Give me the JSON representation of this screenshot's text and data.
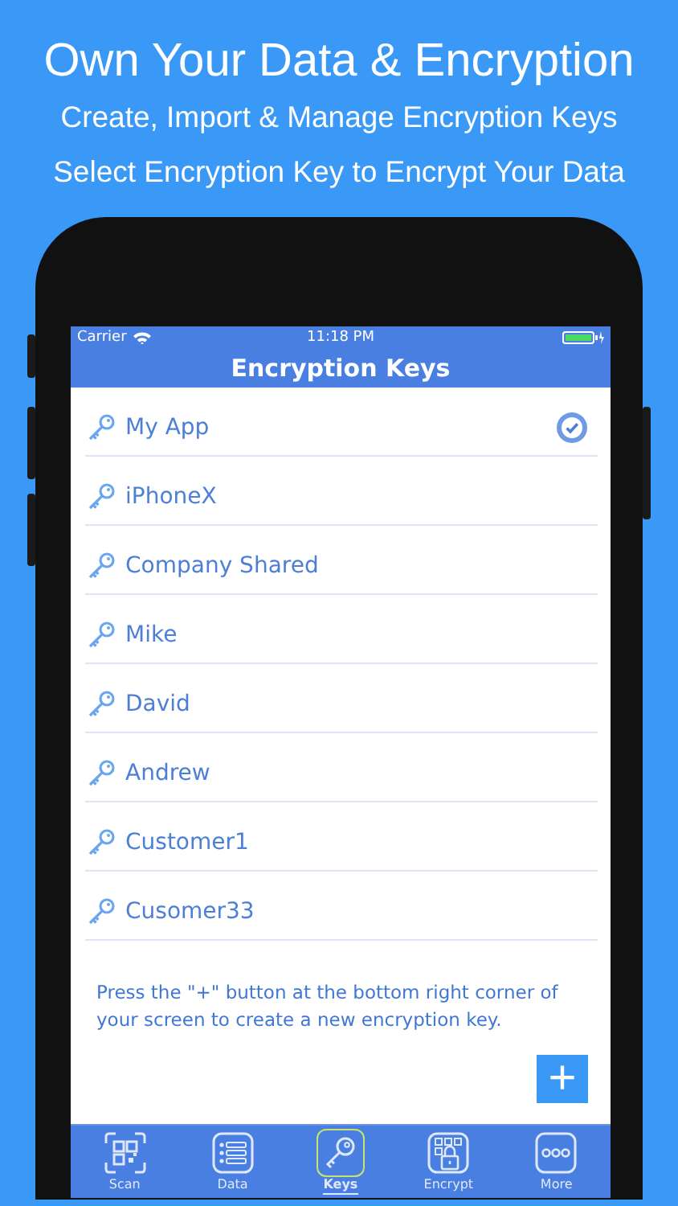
{
  "headline": "Own Your Data & Encryption",
  "subtitles": [
    "Create, Import & Manage Encryption Keys",
    "Select Encryption Key to Encrypt Your Data"
  ],
  "status_bar": {
    "carrier": "Carrier",
    "time": "11:18 PM"
  },
  "nav_title": "Encryption Keys",
  "keys": [
    {
      "name": "My App",
      "selected": true
    },
    {
      "name": "iPhoneX",
      "selected": false
    },
    {
      "name": "Company Shared",
      "selected": false
    },
    {
      "name": "Mike",
      "selected": false
    },
    {
      "name": "David",
      "selected": false
    },
    {
      "name": "Andrew",
      "selected": false
    },
    {
      "name": "Customer1",
      "selected": false
    },
    {
      "name": "Cusomer33",
      "selected": false
    }
  ],
  "hint": "Press the \"+\" button at the bottom right corner of your screen to create a new encryption key.",
  "add_button": "+",
  "tabs": [
    {
      "label": "Scan",
      "kind": "scan",
      "selected": false
    },
    {
      "label": "Data",
      "kind": "data",
      "selected": false
    },
    {
      "label": "Keys",
      "kind": "keys",
      "selected": true
    },
    {
      "label": "Encrypt",
      "kind": "encrypt",
      "selected": false
    },
    {
      "label": "More",
      "kind": "more",
      "selected": false
    }
  ]
}
